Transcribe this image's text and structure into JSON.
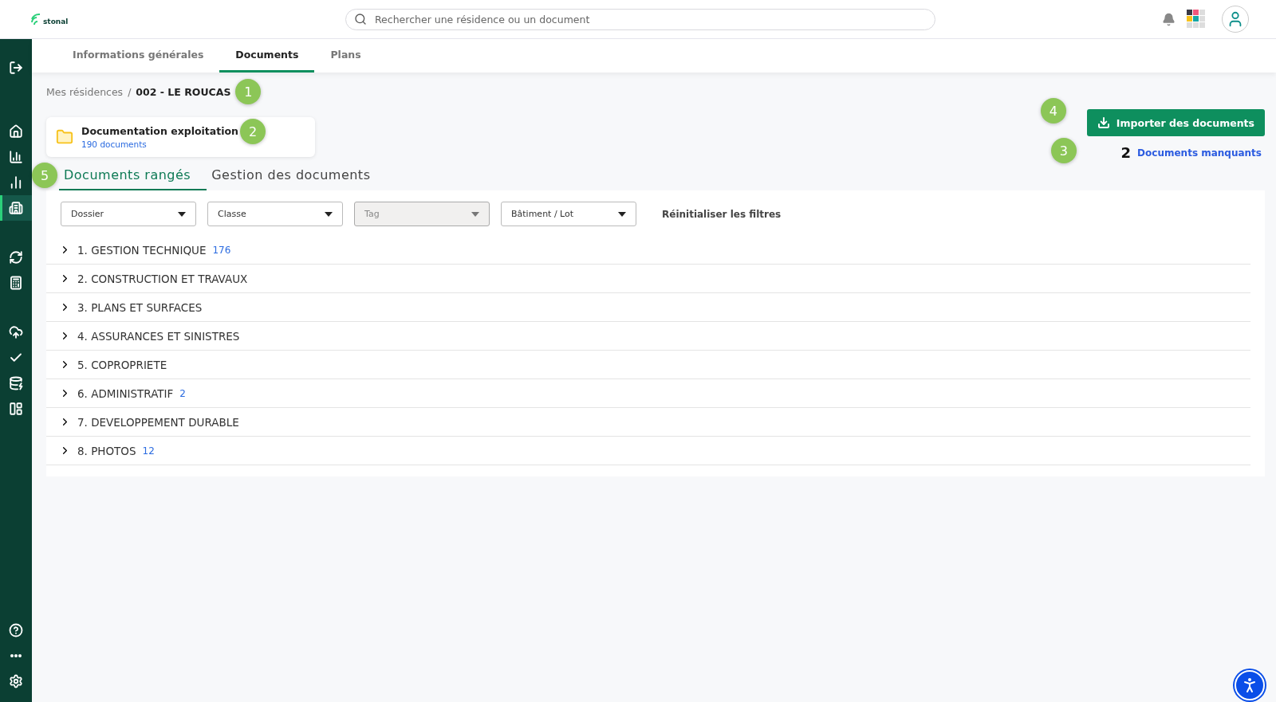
{
  "header": {
    "logo": "stonal",
    "search": {
      "placeholder": "Rechercher une résidence ou un document"
    }
  },
  "sidebar": {
    "top": [
      {
        "selected": false
      }
    ],
    "main": [
      {
        "selected": false
      },
      {
        "selected": false
      },
      {
        "selected": false
      },
      {
        "selected": true
      }
    ],
    "tools": [
      {
        "selected": false
      },
      {
        "selected": false
      }
    ],
    "data": [
      {
        "selected": false
      },
      {
        "selected": false
      },
      {
        "selected": false
      },
      {
        "selected": false
      }
    ],
    "bottom": [
      {
        "selected": false
      },
      {
        "selected": false
      },
      {
        "selected": false
      }
    ]
  },
  "tabs": [
    {
      "label": "Informations générales",
      "selected": false
    },
    {
      "label": "Documents",
      "selected": true
    },
    {
      "label": "Plans",
      "selected": false
    }
  ],
  "breadcrumb": {
    "separator": "/",
    "items": [
      {
        "label": "Mes résidences",
        "current": false
      },
      {
        "label": "002 - LE ROUCAS",
        "current": true
      }
    ]
  },
  "folder_card": {
    "title": "Documentation exploitation",
    "count": "190 documents"
  },
  "import_button": "Importer des documents",
  "missing": {
    "count": "2",
    "label": "Documents manquants"
  },
  "subtabs": [
    {
      "label": "Documents rangés",
      "selected": true
    },
    {
      "label": "Gestion des documents",
      "selected": false
    }
  ],
  "filters": [
    {
      "placeholder": "Dossier",
      "disabled": false
    },
    {
      "placeholder": "Classe",
      "disabled": false
    },
    {
      "placeholder": "Tag",
      "disabled": true
    },
    {
      "placeholder": "Bâtiment / Lot",
      "disabled": false
    }
  ],
  "reset_filters": "Réinitialiser les filtres",
  "folders": [
    {
      "label": "1. GESTION TECHNIQUE",
      "count": "176",
      "expanded": false
    },
    {
      "label": "2. CONSTRUCTION ET TRAVAUX",
      "expanded": false
    },
    {
      "label": "3. PLANS ET SURFACES",
      "expanded": false
    },
    {
      "label": "4. ASSURANCES ET SINISTRES",
      "expanded": false
    },
    {
      "label": "5. COPROPRIETE",
      "expanded": false
    },
    {
      "label": "6. ADMINISTRATIF",
      "count": "2",
      "expanded": false
    },
    {
      "label": "7. DEVELOPPEMENT DURABLE",
      "expanded": false
    },
    {
      "label": "8. PHOTOS",
      "count": "12",
      "expanded": false
    }
  ],
  "markers": [
    "1",
    "2",
    "3",
    "4",
    "5"
  ]
}
